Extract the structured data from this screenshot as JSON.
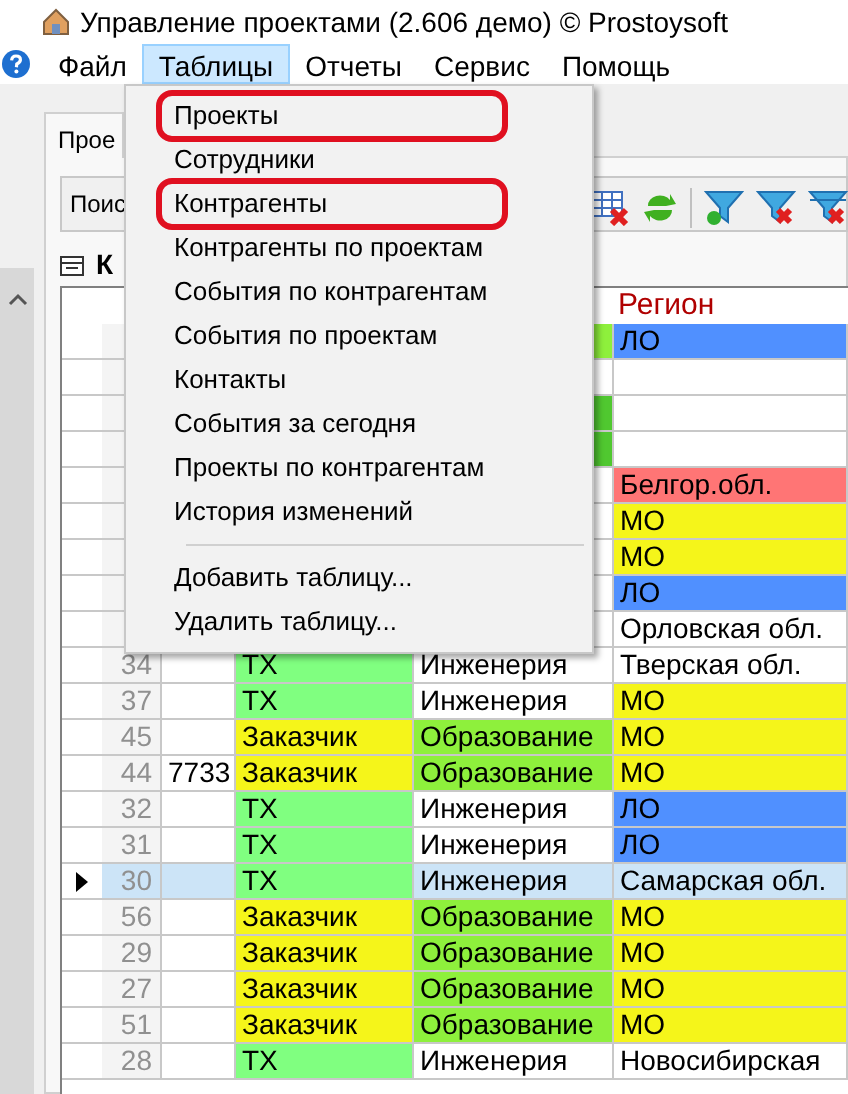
{
  "window": {
    "title": "Управление проектами (2.606 демо) © Prostoysoft"
  },
  "menu_bar": [
    {
      "label": "Файл",
      "selected": false
    },
    {
      "label": "Таблицы",
      "selected": true
    },
    {
      "label": "Отчеты",
      "selected": false
    },
    {
      "label": "Сервис",
      "selected": false
    },
    {
      "label": "Помощь",
      "selected": false
    }
  ],
  "dropdown": [
    {
      "kind": "item",
      "label": "Проекты",
      "circled": true
    },
    {
      "kind": "item",
      "label": "Сотрудники",
      "circled": false
    },
    {
      "kind": "item",
      "label": "Контрагенты",
      "circled": true
    },
    {
      "kind": "item",
      "label": "Контрагенты по проектам",
      "circled": false
    },
    {
      "kind": "item",
      "label": "События по контрагентам",
      "circled": false
    },
    {
      "kind": "item",
      "label": "События по проектам",
      "circled": false
    },
    {
      "kind": "item",
      "label": "Контакты",
      "circled": false
    },
    {
      "kind": "item",
      "label": "События за сегодня",
      "circled": false
    },
    {
      "kind": "item",
      "label": "Проекты по контрагентам",
      "circled": false
    },
    {
      "kind": "item",
      "label": "История изменений",
      "circled": false
    },
    {
      "kind": "separator"
    },
    {
      "kind": "item",
      "label": "Добавить таблицу...",
      "circled": false
    },
    {
      "kind": "item",
      "label": "Удалить таблицу...",
      "circled": false
    }
  ],
  "tab": {
    "label": "Прое"
  },
  "toolbar": {
    "search_label": "Поис"
  },
  "grid_label": "К",
  "table": {
    "columns": [
      {
        "label": "Регион"
      }
    ],
    "rows": [
      {
        "selected": false,
        "field": {
          "color": "#8ef03c"
        },
        "region": {
          "text": "ЛО",
          "color": "#5090ff"
        }
      },
      {
        "selected": false
      },
      {
        "selected": false,
        "field": {
          "color": "#50c830"
        }
      },
      {
        "selected": false,
        "field": {
          "color": "#50c830"
        }
      },
      {
        "selected": false,
        "region": {
          "text": "Белгор.обл.",
          "color": "#ff7575"
        }
      },
      {
        "selected": false,
        "region": {
          "text": "МО",
          "color": "#f5f51a"
        }
      },
      {
        "selected": false,
        "region": {
          "text": "МО",
          "color": "#f5f51a"
        }
      },
      {
        "selected": false,
        "region": {
          "text": "ЛО",
          "color": "#5090ff"
        }
      },
      {
        "selected": false,
        "region": {
          "text": "Орловская обл."
        }
      },
      {
        "selected": false,
        "num": "34",
        "type": {
          "text": "ТХ",
          "color": "#80ff80"
        },
        "field": {
          "text": "Инженерия"
        },
        "region": {
          "text": "Тверская обл."
        }
      },
      {
        "selected": false,
        "num": "37",
        "type": {
          "text": "ТХ",
          "color": "#80ff80"
        },
        "field": {
          "text": "Инженерия"
        },
        "region": {
          "text": "МО",
          "color": "#f5f51a"
        }
      },
      {
        "selected": false,
        "num": "45",
        "type": {
          "text": "Заказчик",
          "color": "#f5f51a"
        },
        "field": {
          "text": "Образование",
          "color": "#8ef03c"
        },
        "region": {
          "text": "МО",
          "color": "#f5f51a"
        }
      },
      {
        "selected": false,
        "num": "44",
        "inn": "7733",
        "type": {
          "text": "Заказчик",
          "color": "#f5f51a"
        },
        "field": {
          "text": "Образование",
          "color": "#8ef03c"
        },
        "region": {
          "text": "МО",
          "color": "#f5f51a"
        }
      },
      {
        "selected": false,
        "num": "32",
        "type": {
          "text": "ТХ",
          "color": "#80ff80"
        },
        "field": {
          "text": "Инженерия"
        },
        "region": {
          "text": "ЛО",
          "color": "#5090ff"
        }
      },
      {
        "selected": false,
        "num": "31",
        "type": {
          "text": "ТХ",
          "color": "#80ff80"
        },
        "field": {
          "text": "Инженерия"
        },
        "region": {
          "text": "ЛО",
          "color": "#5090ff"
        }
      },
      {
        "selected": true,
        "num": "30",
        "type": {
          "text": "ТХ",
          "color": "#80ff80"
        },
        "field": {
          "text": "Инженерия"
        },
        "region": {
          "text": "Самарская обл."
        }
      },
      {
        "selected": false,
        "num": "56",
        "type": {
          "text": "Заказчик",
          "color": "#f5f51a"
        },
        "field": {
          "text": "Образование",
          "color": "#8ef03c"
        },
        "region": {
          "text": "МО",
          "color": "#f5f51a"
        }
      },
      {
        "selected": false,
        "num": "29",
        "type": {
          "text": "Заказчик",
          "color": "#f5f51a"
        },
        "field": {
          "text": "Образование",
          "color": "#8ef03c"
        },
        "region": {
          "text": "МО",
          "color": "#f5f51a"
        }
      },
      {
        "selected": false,
        "num": "27",
        "type": {
          "text": "Заказчик",
          "color": "#f5f51a"
        },
        "field": {
          "text": "Образование",
          "color": "#8ef03c"
        },
        "region": {
          "text": "МО",
          "color": "#f5f51a"
        }
      },
      {
        "selected": false,
        "num": "51",
        "type": {
          "text": "Заказчик",
          "color": "#f5f51a"
        },
        "field": {
          "text": "Образование",
          "color": "#8ef03c"
        },
        "region": {
          "text": "МО",
          "color": "#f5f51a"
        }
      },
      {
        "selected": false,
        "num": "28",
        "type": {
          "text": "ТХ",
          "color": "#80ff80"
        },
        "field": {
          "text": "Инженерия"
        },
        "region": {
          "text": "Новосибирская"
        }
      }
    ]
  }
}
